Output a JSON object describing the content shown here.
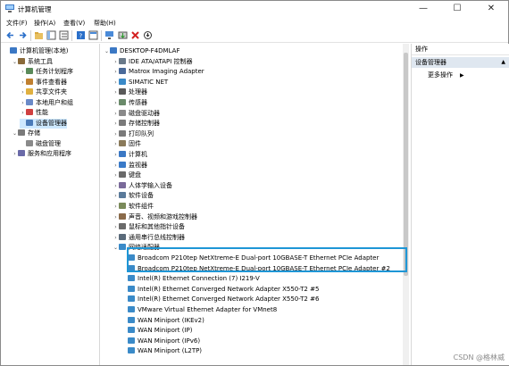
{
  "window": {
    "title": "计算机管理"
  },
  "menu": [
    "文件(F)",
    "操作(A)",
    "查看(V)",
    "帮助(H)"
  ],
  "left_tree": [
    {
      "label": "计算机管理(本地)",
      "level": 0,
      "exp": "",
      "icon": "computer-icon"
    },
    {
      "label": "系统工具",
      "level": 1,
      "exp": "⌄",
      "icon": "tools-icon"
    },
    {
      "label": "任务计划程序",
      "level": 2,
      "exp": "›",
      "icon": "clock-icon"
    },
    {
      "label": "事件查看器",
      "level": 2,
      "exp": "›",
      "icon": "event-icon"
    },
    {
      "label": "共享文件夹",
      "level": 2,
      "exp": "›",
      "icon": "folder-icon"
    },
    {
      "label": "本地用户和组",
      "level": 2,
      "exp": "›",
      "icon": "users-icon"
    },
    {
      "label": "性能",
      "level": 2,
      "exp": "›",
      "icon": "performance-icon"
    },
    {
      "label": "设备管理器",
      "level": 2,
      "exp": "",
      "icon": "device-manager-icon",
      "selected": true
    },
    {
      "label": "存储",
      "level": 1,
      "exp": "⌄",
      "icon": "storage-icon"
    },
    {
      "label": "磁盘管理",
      "level": 2,
      "exp": "",
      "icon": "disk-icon"
    },
    {
      "label": "服务和应用程序",
      "level": 1,
      "exp": "›",
      "icon": "services-icon"
    }
  ],
  "device_tree": [
    {
      "label": "DESKTOP-F4DMLAF",
      "level": 0,
      "exp": "⌄",
      "icon": "computer-icon"
    },
    {
      "label": "IDE ATA/ATAPI 控制器",
      "level": 1,
      "exp": "›",
      "icon": "controller-icon"
    },
    {
      "label": "Matrox Imaging Adapter",
      "level": 1,
      "exp": "›",
      "icon": "adapter-icon"
    },
    {
      "label": "SIMATIC NET",
      "level": 1,
      "exp": "›",
      "icon": "network-icon"
    },
    {
      "label": "处理器",
      "level": 1,
      "exp": "›",
      "icon": "cpu-icon"
    },
    {
      "label": "传感器",
      "level": 1,
      "exp": "›",
      "icon": "sensor-icon"
    },
    {
      "label": "磁盘驱动器",
      "level": 1,
      "exp": "›",
      "icon": "disk-icon"
    },
    {
      "label": "存储控制器",
      "level": 1,
      "exp": "›",
      "icon": "storage-icon"
    },
    {
      "label": "打印队列",
      "level": 1,
      "exp": "›",
      "icon": "printer-icon"
    },
    {
      "label": "固件",
      "level": 1,
      "exp": "›",
      "icon": "firmware-icon"
    },
    {
      "label": "计算机",
      "level": 1,
      "exp": "›",
      "icon": "computer-icon"
    },
    {
      "label": "监视器",
      "level": 1,
      "exp": "›",
      "icon": "monitor-icon"
    },
    {
      "label": "键盘",
      "level": 1,
      "exp": "›",
      "icon": "keyboard-icon"
    },
    {
      "label": "人体学输入设备",
      "level": 1,
      "exp": "›",
      "icon": "hid-icon"
    },
    {
      "label": "软件设备",
      "level": 1,
      "exp": "›",
      "icon": "software-icon"
    },
    {
      "label": "软件组件",
      "level": 1,
      "exp": "›",
      "icon": "component-icon"
    },
    {
      "label": "声音、视频和游戏控制器",
      "level": 1,
      "exp": "›",
      "icon": "audio-icon"
    },
    {
      "label": "鼠标和其他指针设备",
      "level": 1,
      "exp": "›",
      "icon": "mouse-icon"
    },
    {
      "label": "通用串行总线控制器",
      "level": 1,
      "exp": "›",
      "icon": "usb-icon"
    },
    {
      "label": "网络适配器",
      "level": 1,
      "exp": "⌄",
      "icon": "network-icon"
    },
    {
      "label": "Broadcom P210tep NetXtreme-E Dual-port 10GBASE-T Ethernet PCIe Adapter",
      "level": 2,
      "exp": "",
      "icon": "nic-icon"
    },
    {
      "label": "Broadcom P210tep NetXtreme-E Dual-port 10GBASE-T Ethernet PCIe Adapter #2",
      "level": 2,
      "exp": "",
      "icon": "nic-icon"
    },
    {
      "label": "Intel(R) Ethernet Connection (7) I219-V",
      "level": 2,
      "exp": "",
      "icon": "nic-icon"
    },
    {
      "label": "Intel(R) Ethernet Converged Network Adapter X550-T2 #5",
      "level": 2,
      "exp": "",
      "icon": "nic-icon"
    },
    {
      "label": "Intel(R) Ethernet Converged Network Adapter X550-T2 #6",
      "level": 2,
      "exp": "",
      "icon": "nic-icon"
    },
    {
      "label": "VMware Virtual Ethernet Adapter for VMnet8",
      "level": 2,
      "exp": "",
      "icon": "nic-icon"
    },
    {
      "label": "WAN Miniport (IKEv2)",
      "level": 2,
      "exp": "",
      "icon": "nic-icon"
    },
    {
      "label": "WAN Miniport (IP)",
      "level": 2,
      "exp": "",
      "icon": "nic-icon"
    },
    {
      "label": "WAN Miniport (IPv6)",
      "level": 2,
      "exp": "",
      "icon": "nic-icon"
    },
    {
      "label": "WAN Miniport (L2TP)",
      "level": 2,
      "exp": "",
      "icon": "nic-icon"
    }
  ],
  "right_pane": {
    "header": "操作",
    "section": "设备管理器",
    "item": "更多操作"
  },
  "watermark": "CSDN @格林威",
  "colors": {
    "highlight_border": "#1e96d6",
    "selected_bg": "#cde8ff",
    "section_bg": "#dfe7f0"
  }
}
